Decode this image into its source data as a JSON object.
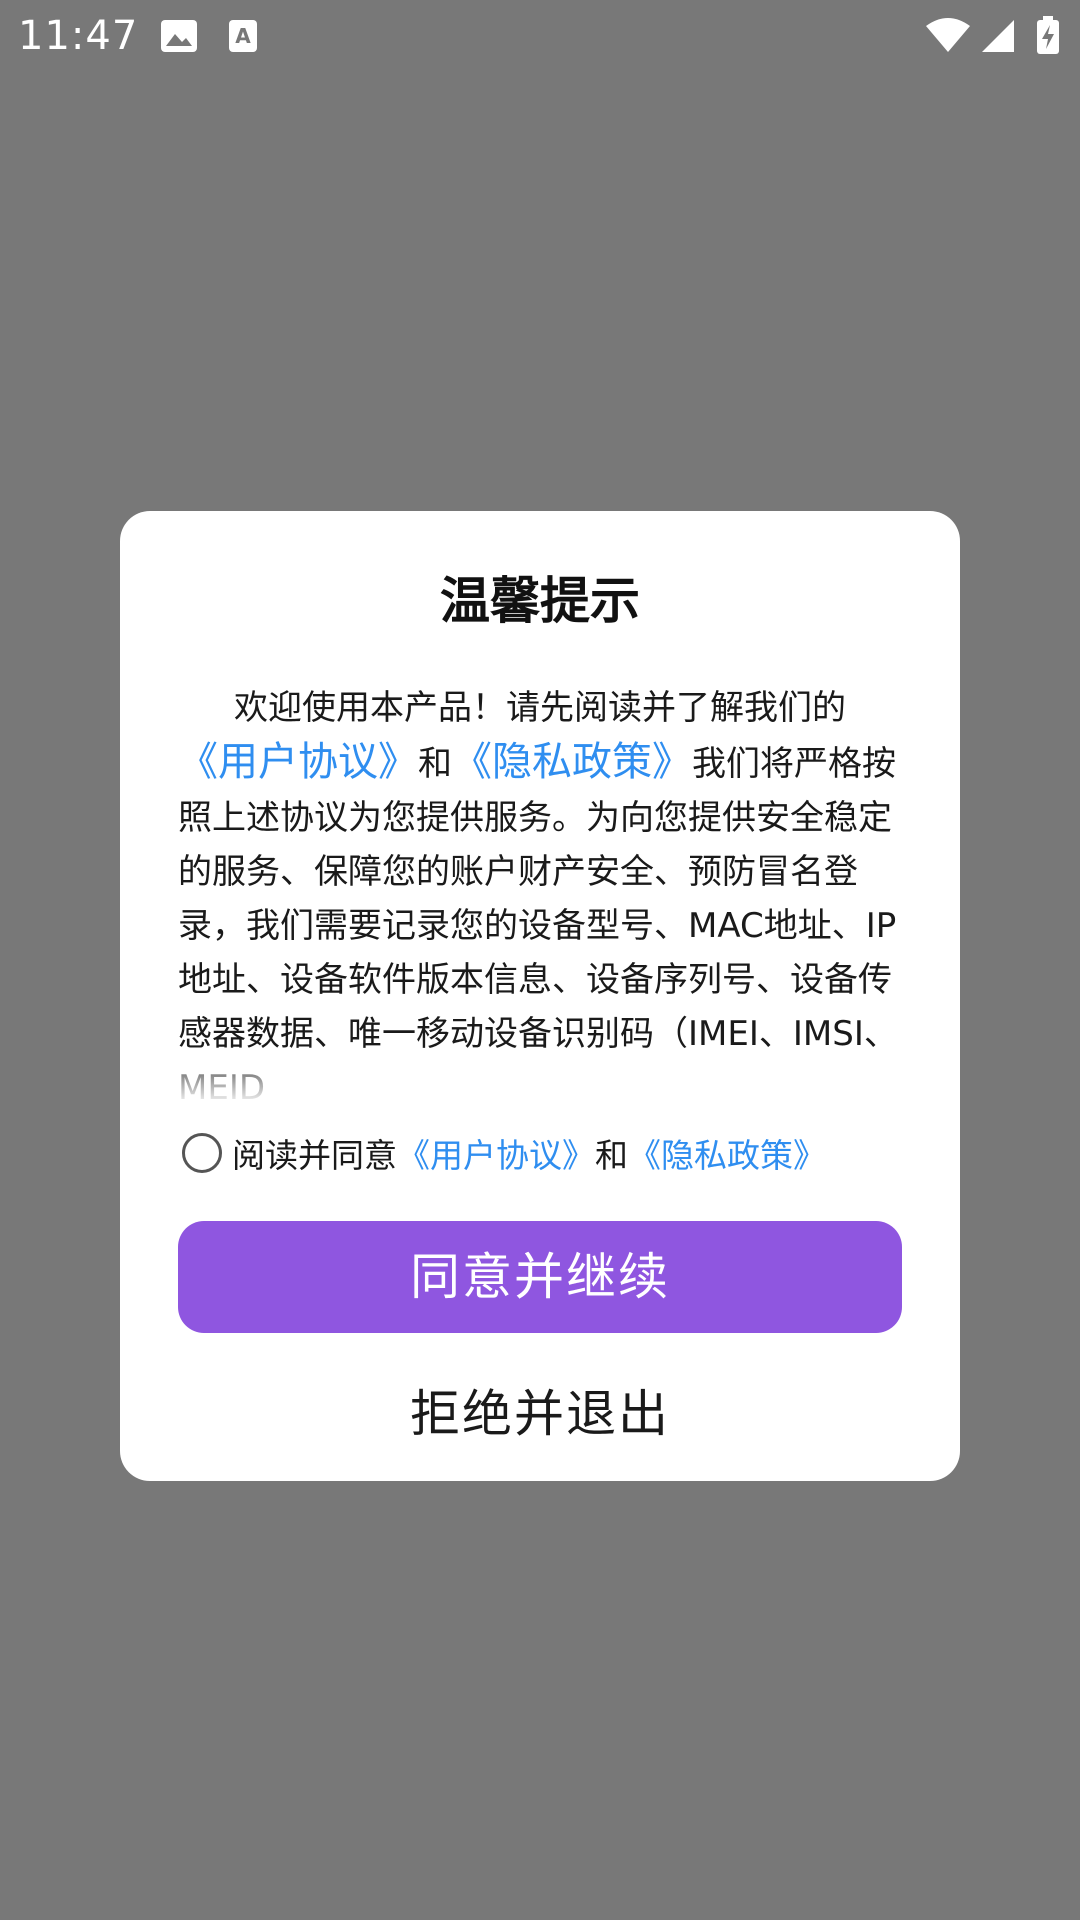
{
  "status_bar": {
    "time": "11:47",
    "icons": [
      "image-icon",
      "font-icon",
      "wifi-icon",
      "signal-icon",
      "battery-charging-icon"
    ]
  },
  "dialog": {
    "title": "温馨提示",
    "body": {
      "intro": "欢迎使用本产品！请先阅读并了解我们的",
      "user_agreement_link": "《用户协议》",
      "and": "和",
      "privacy_policy_link": "《隐私政策》",
      "rest": "我们将严格按照上述协议为您提供服务。为向您提供安全稳定的服务、保障您的账户财产安全、预防冒名登录，我们需要记录您的设备型号、MAC地址、IP地址、设备软件版本信息、设备序列号、设备传感器数据、唯一移动设备识别码（IMEI、IMSI、MEID"
    },
    "agree_row": {
      "label": "阅读并同意",
      "user_agreement_link": "《用户协议》",
      "and": "和",
      "privacy_policy_link": "《隐私政策》",
      "checked": false
    },
    "primary_button": "同意并继续",
    "secondary_button": "拒绝并退出"
  },
  "colors": {
    "overlay": "#787878",
    "link": "#2f8ef0",
    "primary_button": "#8f56e0"
  }
}
